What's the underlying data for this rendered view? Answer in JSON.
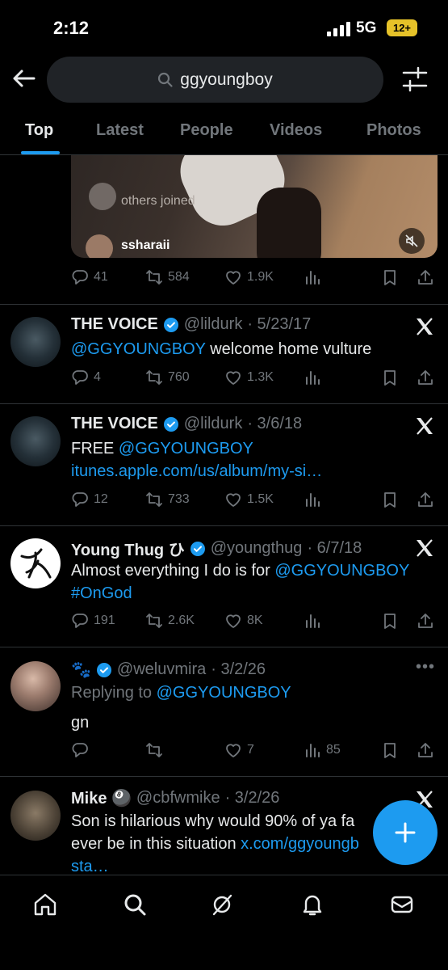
{
  "status_bar": {
    "time": "2:12",
    "network": "5G",
    "battery": "12+"
  },
  "search": {
    "query": "ggyoungboy"
  },
  "tabs": [
    {
      "label": "Top",
      "active": true
    },
    {
      "label": "Latest"
    },
    {
      "label": "People"
    },
    {
      "label": "Videos"
    },
    {
      "label": "Photos"
    }
  ],
  "media_card": {
    "joined_text": "others joined",
    "username": "ssharaii",
    "actions": {
      "replies": "41",
      "reposts": "584",
      "likes": "1.9K"
    }
  },
  "tweets": [
    {
      "name": "THE VOICE",
      "handle": "@lildurk",
      "date": "· 5/23/17",
      "text_mention": "@GGYOUNGBOY",
      "text": " welcome home vulture",
      "replies": "4",
      "reposts": "760",
      "likes": "1.3K"
    },
    {
      "name": "THE VOICE",
      "handle": "@lildurk",
      "date": "· 3/6/18",
      "text_prefix": "FREE ",
      "text_mention": "@GGYOUNGBOY",
      "text_link": " itunes.apple.com/us/album/my-si…",
      "replies": "12",
      "reposts": "733",
      "likes": "1.5K"
    },
    {
      "name": "Young Thug ひ",
      "handle": "@youngthug",
      "date": "· 6/7/18",
      "text": "Almost everything I do is for ",
      "text_mention": "@GGYOUNGBOY",
      "text_tag": "#OnGod",
      "replies": "191",
      "reposts": "2.6K",
      "likes": "8K"
    },
    {
      "name": "🐾",
      "handle": "@weluvmira",
      "date": "· 3/2/26",
      "replying_to_label": "Replying to ",
      "replying_to": "@GGYOUNGBOY",
      "text": "gn",
      "likes": "7",
      "views": "85"
    },
    {
      "name": "Mike 🎱",
      "handle": "@cbfwmike",
      "date": "· 3/2/26",
      "text": "Son is hilarious why would 90% of ya fa ever be in this situation ",
      "text_link": "x.com/ggyoungb sta…"
    }
  ],
  "colors": {
    "accent": "#1d9bf0",
    "muted": "#71767b",
    "background": "#000000",
    "battery": "#e6c229"
  }
}
